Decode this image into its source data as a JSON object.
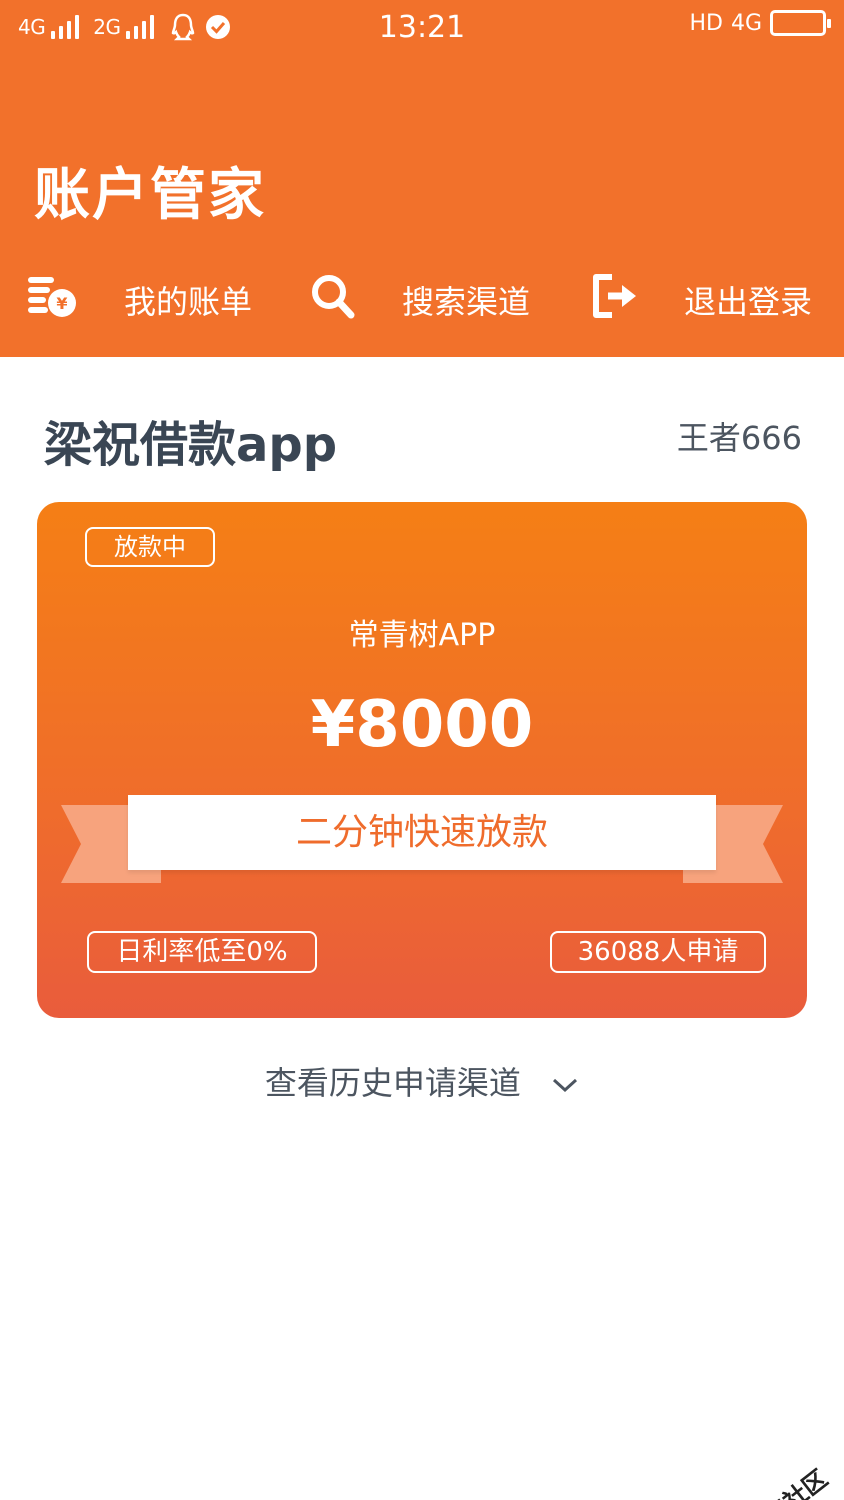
{
  "status_bar": {
    "net1": "4G",
    "net2": "2G",
    "time": "13:21",
    "right_text": "HD",
    "right_net": "4G"
  },
  "header": {
    "title": "账户管家",
    "nav": [
      {
        "label": "我的账单",
        "icon": "bill-icon"
      },
      {
        "label": "搜索渠道",
        "icon": "search-icon"
      },
      {
        "label": "退出登录",
        "icon": "logout-icon"
      }
    ]
  },
  "main": {
    "loan_title": "梁祝借款app",
    "username": "王者666",
    "card": {
      "status": "放款中",
      "product": "常青树APP",
      "amount": "¥8000",
      "slogan": "二分钟快速放款",
      "rate": "日利率低至0%",
      "applicants": "36088人申请"
    },
    "history_label": "查看历史申请渠道"
  },
  "watermark": "卡农社区",
  "colors": {
    "header_bg": "#f2712b",
    "card_top": "#f57f15",
    "card_bottom": "#e95c3c",
    "text_dark": "#3a4654"
  }
}
